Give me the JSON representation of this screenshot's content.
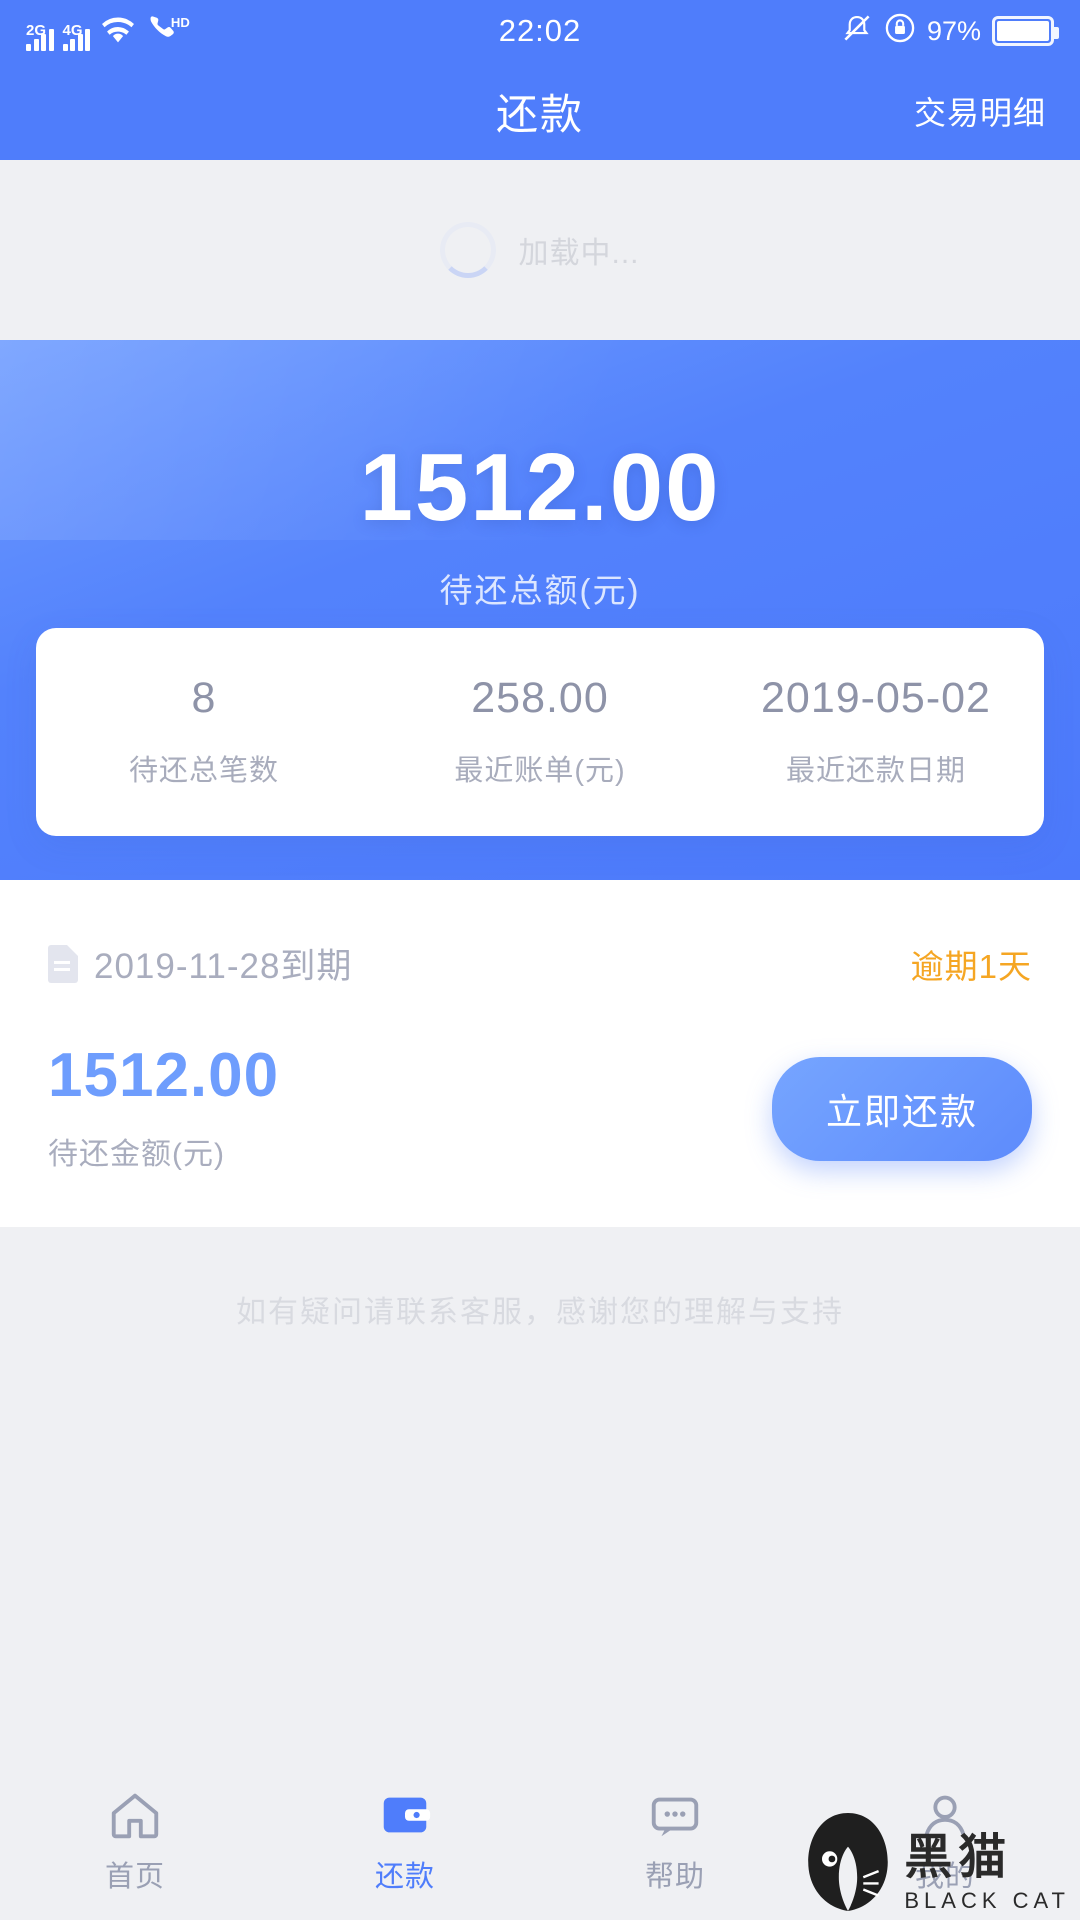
{
  "statusbar": {
    "net_2g": "2G",
    "net_4g": "4G",
    "hd_label": "HD",
    "time": "22:02",
    "battery_percent": "97%"
  },
  "header": {
    "title": "还款",
    "action_label": "交易明细"
  },
  "loading": {
    "text": "加载中..."
  },
  "summary": {
    "total_amount": "1512.00",
    "total_label": "待还总额(元)",
    "stats": [
      {
        "value": "8",
        "label": "待还总笔数"
      },
      {
        "value": "258.00",
        "label": "最近账单(元)"
      },
      {
        "value": "2019-05-02",
        "label": "最近还款日期"
      }
    ]
  },
  "repayment_item": {
    "due_text": "2019-11-28到期",
    "overdue_text": "逾期1天",
    "amount": "1512.00",
    "amount_label": "待还金额(元)",
    "pay_button": "立即还款"
  },
  "footnote": {
    "text": "如有疑问请联系客服，感谢您的理解与支持"
  },
  "tabbar": {
    "items": [
      {
        "label": "首页",
        "icon": "home-icon"
      },
      {
        "label": "还款",
        "icon": "wallet-icon"
      },
      {
        "label": "帮助",
        "icon": "chat-icon"
      },
      {
        "label": "我的",
        "icon": "person-icon"
      }
    ],
    "active_index": 1
  },
  "watermark": {
    "cn": "黑猫",
    "en": "BLACK CAT"
  },
  "colors": {
    "brand_blue": "#4f7dfb",
    "accent_orange": "#f5a623",
    "page_bg": "#eff0f3",
    "muted_text": "#a9adbe"
  }
}
